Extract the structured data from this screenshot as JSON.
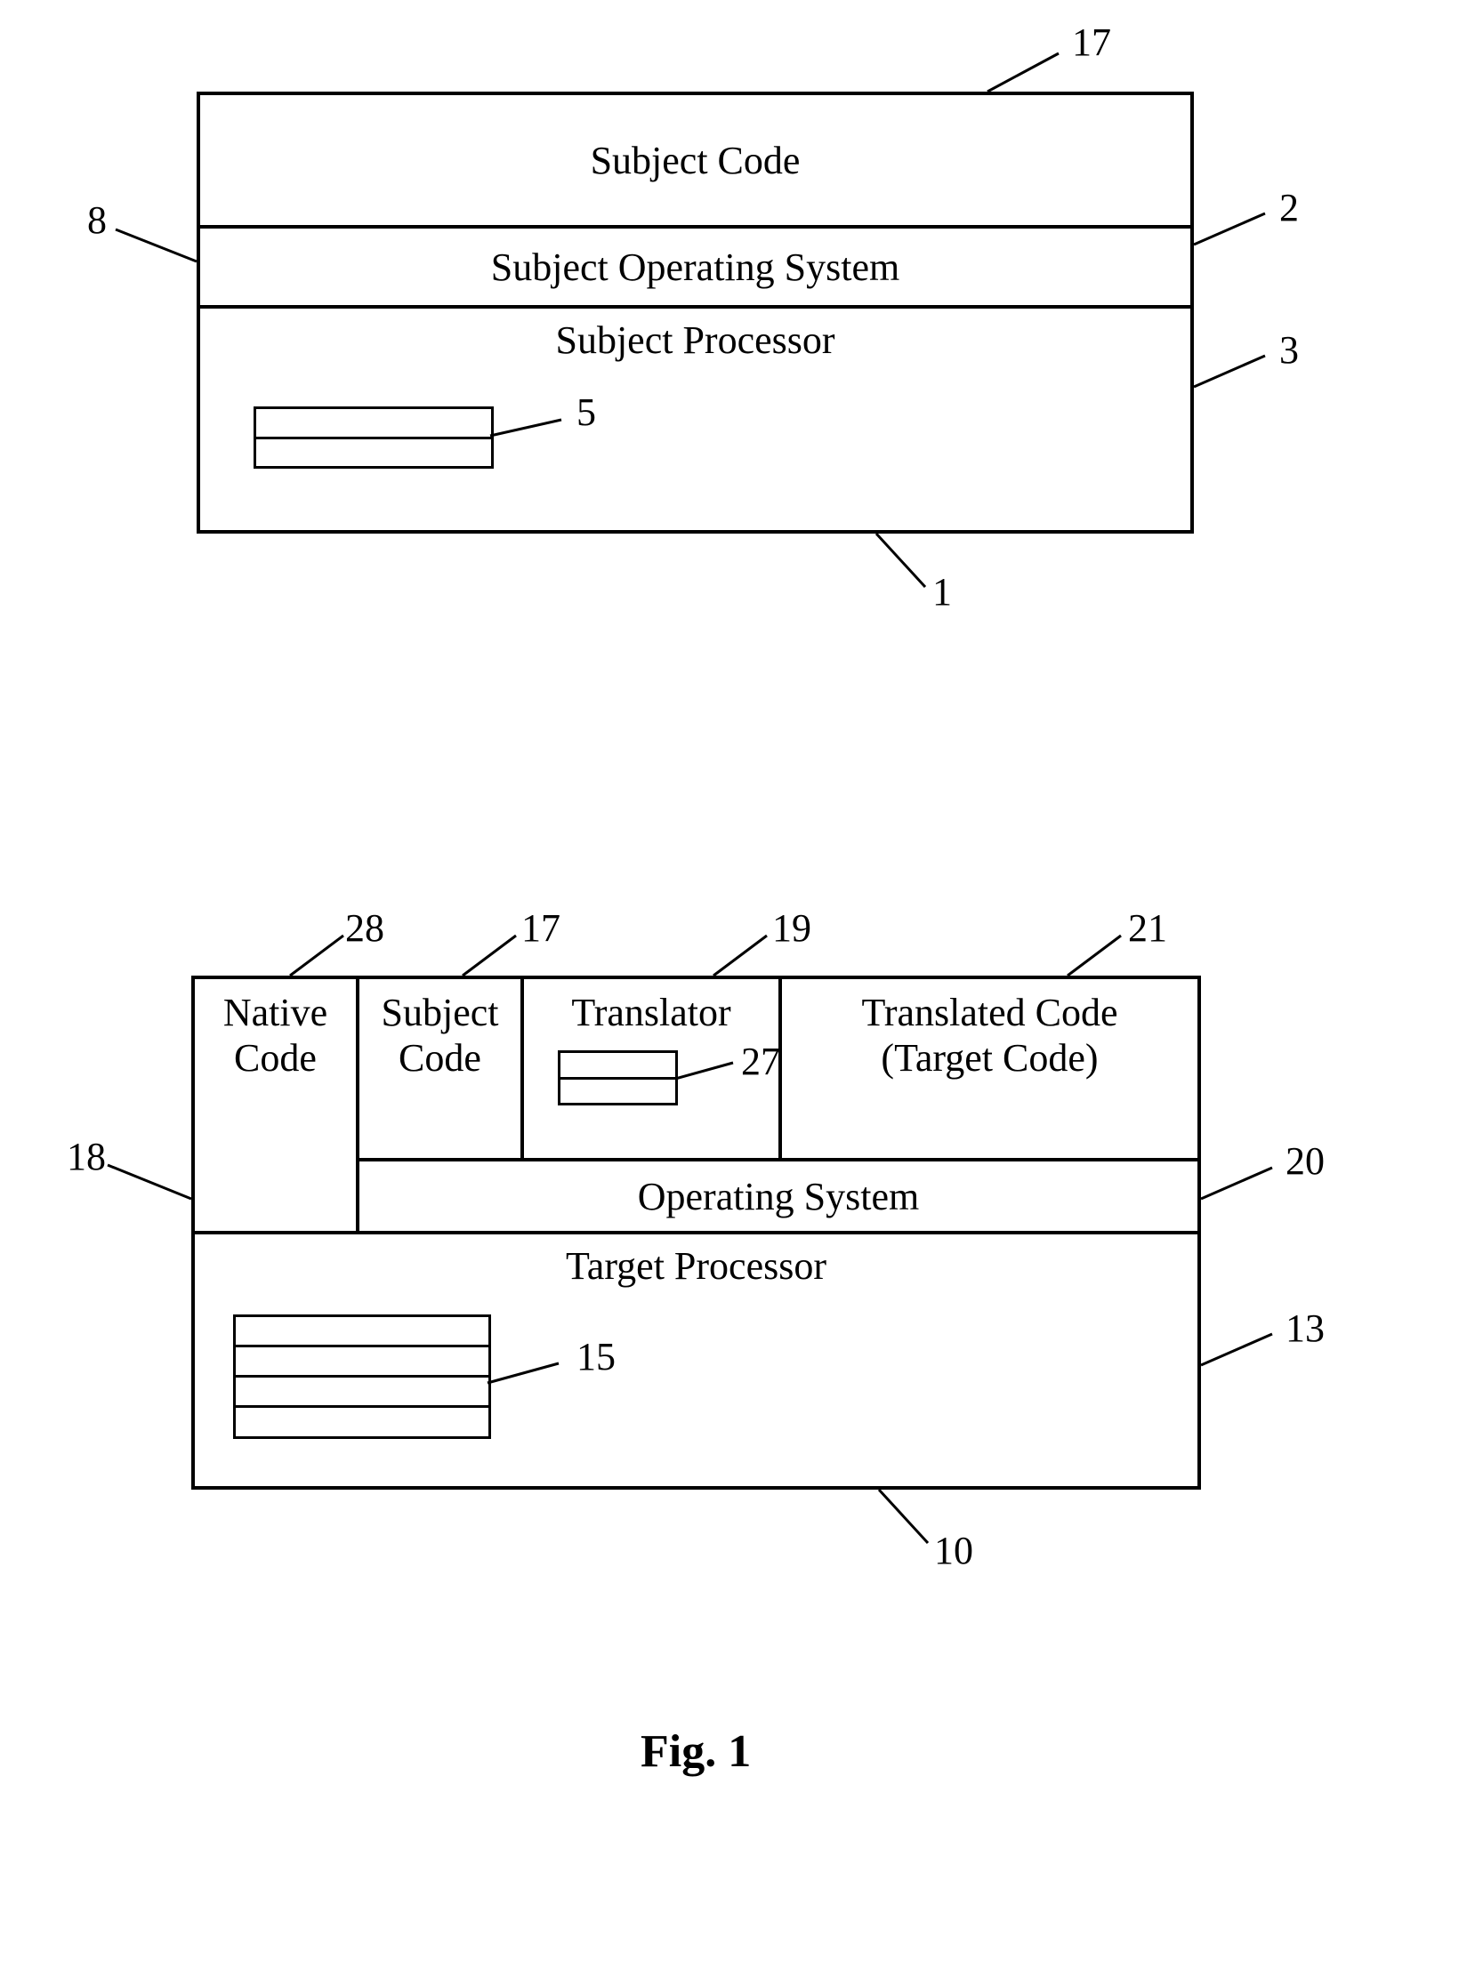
{
  "figure_label": "Fig. 1",
  "top": {
    "callouts": {
      "tl": "8",
      "tr_upper": "17",
      "r_mid": "2",
      "r_lower": "3",
      "reg": "5",
      "bottom": "1"
    },
    "rows": {
      "r1": "Subject Code",
      "r2": "Subject Operating System",
      "r3": "Subject Processor"
    }
  },
  "bottom": {
    "callouts": {
      "tl": "18",
      "c1": "28",
      "c2": "17",
      "c3": "19",
      "c4": "21",
      "inner": "27",
      "r_os": "20",
      "r_proc": "13",
      "reg": "15",
      "bottom": "10"
    },
    "cells": {
      "native_l1": "Native",
      "native_l2": "Code",
      "subject_l1": "Subject",
      "subject_l2": "Code",
      "translator": "Translator",
      "translated_l1": "Translated Code",
      "translated_l2": "(Target Code)"
    },
    "rows": {
      "os": "Operating System",
      "proc": "Target Processor"
    }
  }
}
